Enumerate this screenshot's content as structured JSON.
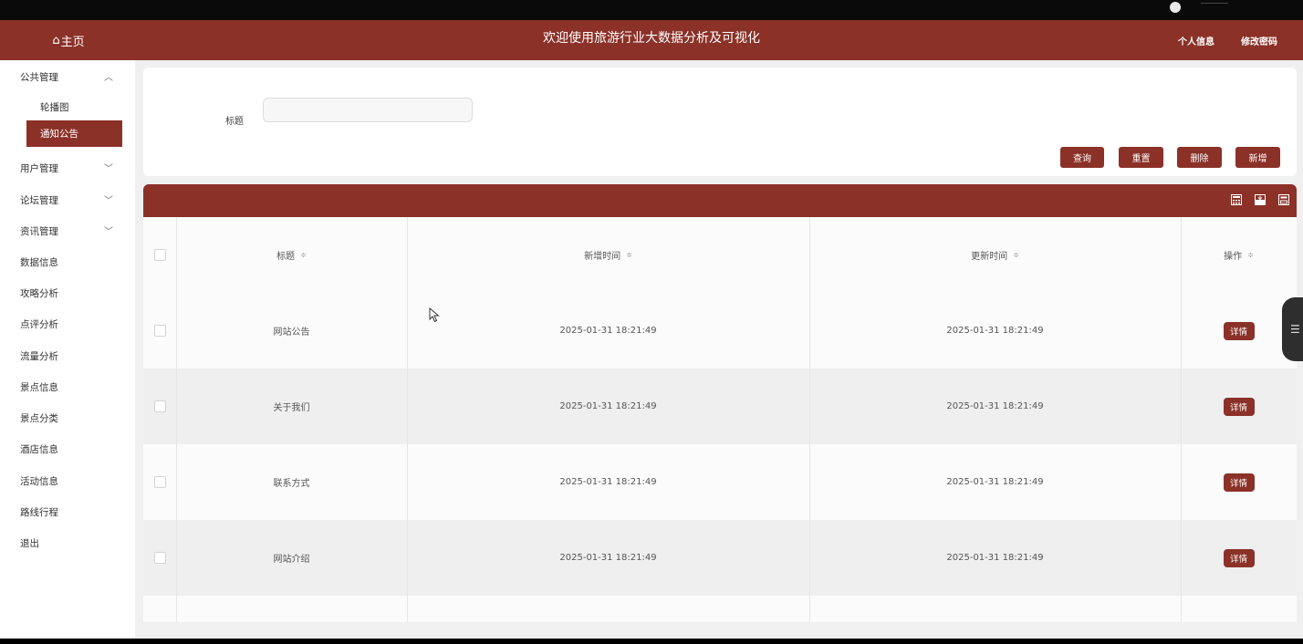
{
  "header": {
    "home_label": "主页",
    "title": "欢迎使用旅游行业大数据分析及可视化",
    "links": [
      "个人信息",
      "修改密码"
    ]
  },
  "sidebar": {
    "groups": [
      {
        "label": "公共管理",
        "expanded": true,
        "children": [
          "轮播图",
          "通知公告"
        ]
      },
      {
        "label": "用户管理",
        "expanded": false
      },
      {
        "label": "论坛管理",
        "expanded": false
      },
      {
        "label": "资讯管理",
        "expanded": false
      }
    ],
    "items": [
      "数据信息",
      "攻略分析",
      "点评分析",
      "流量分析",
      "景点信息",
      "景点分类",
      "酒店信息",
      "活动信息",
      "路线行程",
      "退出"
    ],
    "active_item": "通知公告"
  },
  "search": {
    "label": "标题",
    "placeholder": "",
    "value": "",
    "buttons": [
      "查询",
      "重置",
      "删除",
      "新增"
    ]
  },
  "table": {
    "columns": [
      "标题",
      "新增时间",
      "更新时间",
      "操作"
    ],
    "rows": [
      {
        "title": "网站公告",
        "created": "2025-01-31 18:21:49",
        "updated": "2025-01-31 18:21:49",
        "action": "详情"
      },
      {
        "title": "关于我们",
        "created": "2025-01-31 18:21:49",
        "updated": "2025-01-31 18:21:49",
        "action": "详情"
      },
      {
        "title": "联系方式",
        "created": "2025-01-31 18:21:49",
        "updated": "2025-01-31 18:21:49",
        "action": "详情"
      },
      {
        "title": "网站介绍",
        "created": "2025-01-31 18:21:49",
        "updated": "2025-01-31 18:21:49",
        "action": "详情"
      }
    ]
  },
  "toolbar_icons": [
    "calculator-icon",
    "export-icon",
    "print-icon"
  ],
  "colors": {
    "accent": "#8b3128",
    "background": "#f0f0f0"
  }
}
